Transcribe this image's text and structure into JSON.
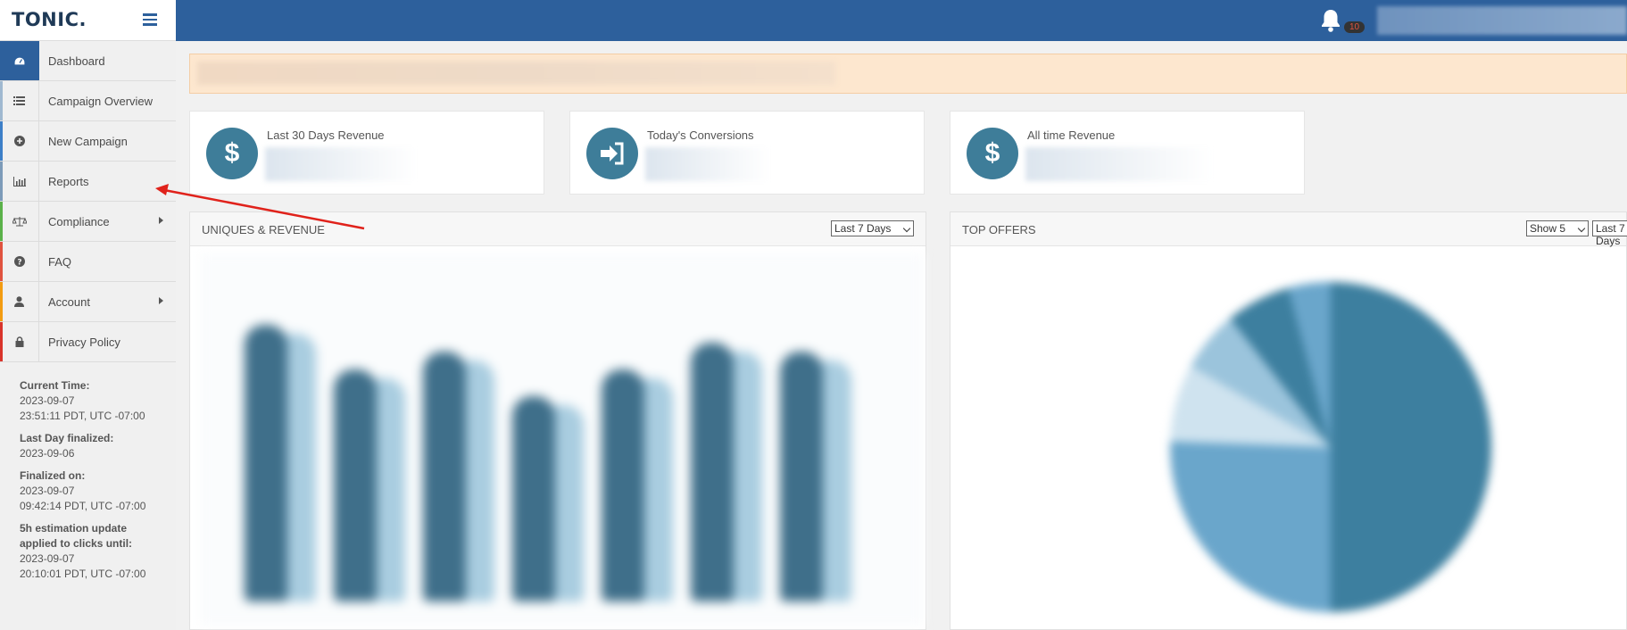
{
  "app": {
    "logo": "TONIC."
  },
  "header": {
    "notifications_count": "10"
  },
  "sidebar": {
    "items": [
      {
        "label": "Dashboard",
        "icon": "dashboard-icon",
        "stripe": "#2d609c",
        "active": true
      },
      {
        "label": "Campaign Overview",
        "icon": "list-icon",
        "stripe": "#9fb8d0"
      },
      {
        "label": "New Campaign",
        "icon": "plus-circle-icon",
        "stripe": "#3d7fc8"
      },
      {
        "label": "Reports",
        "icon": "bar-chart-icon",
        "stripe": "#7d9bb9"
      },
      {
        "label": "Compliance",
        "icon": "balance-scale-icon",
        "stripe": "#5bb14a",
        "has_submenu": true
      },
      {
        "label": "FAQ",
        "icon": "question-circle-icon",
        "stripe": "#e0533f"
      },
      {
        "label": "Account",
        "icon": "user-icon",
        "stripe": "#f39c12",
        "has_submenu": true
      },
      {
        "label": "Privacy Policy",
        "icon": "lock-icon",
        "stripe": "#d9342b"
      }
    ],
    "info": {
      "current_time_label": "Current Time:",
      "current_time_date": "2023-09-07",
      "current_time_value": "23:51:11 PDT, UTC -07:00",
      "last_day_label": "Last Day finalized:",
      "last_day_value": "2023-09-06",
      "finalized_label": "Finalized on:",
      "finalized_date": "2023-09-07",
      "finalized_time": "09:42:14 PDT, UTC -07:00",
      "estimation_label_1": "5h estimation update",
      "estimation_label_2": "applied to clicks until:",
      "estimation_date": "2023-09-07",
      "estimation_time": "20:10:01 PDT, UTC -07:00"
    }
  },
  "stats": [
    {
      "title": "Last 30 Days Revenue",
      "icon": "dollar-icon"
    },
    {
      "title": "Today's Conversions",
      "icon": "sign-in-icon"
    },
    {
      "title": "All time Revenue",
      "icon": "dollar-icon"
    }
  ],
  "panels": {
    "uniques": {
      "title": "UNIQUES & REVENUE",
      "range_selected": "Last 7 Days"
    },
    "offers": {
      "title": "TOP OFFERS",
      "show_selected": "Show 5",
      "range_selected": "Last 7 Days"
    }
  },
  "colors": {
    "topbar": "#2d609c",
    "accent": "#3e7d99",
    "banner": "#fde7cf"
  }
}
